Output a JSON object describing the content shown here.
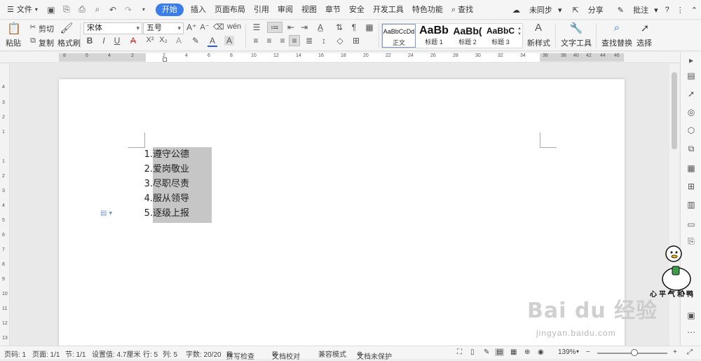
{
  "menu": {
    "file": "文件",
    "tabs": [
      "开始",
      "插入",
      "页面布局",
      "引用",
      "审阅",
      "视图",
      "章节",
      "安全",
      "开发工具",
      "特色功能"
    ],
    "search": "查找",
    "sync": "未同步",
    "share": "分享",
    "comment": "批注"
  },
  "ribbon": {
    "paste": "粘贴",
    "cut": "剪切",
    "copy": "复制",
    "format_painter": "格式刷",
    "font_name": "宋体",
    "font_size": "五号",
    "styles": [
      {
        "sample": "AaBbCcDd",
        "name": "正文"
      },
      {
        "sample": "AaBb",
        "name": "标题 1"
      },
      {
        "sample": "AaBb(",
        "name": "标题 2"
      },
      {
        "sample": "AaBbC",
        "name": "标题 3"
      }
    ],
    "new_style": "新样式",
    "text_tools": "文字工具",
    "find_replace": "查找替换",
    "select": "选择"
  },
  "ruler": {
    "h_ticks": [
      "8",
      "6",
      "4",
      "2",
      "2",
      "4",
      "6",
      "8",
      "10",
      "12",
      "14",
      "16",
      "18",
      "20",
      "22",
      "24",
      "26",
      "28",
      "30",
      "32",
      "34",
      "36",
      "38",
      "40",
      "42",
      "44",
      "46"
    ],
    "v_ticks": [
      "4",
      "3",
      "2",
      "1",
      "1",
      "2",
      "3",
      "4",
      "5",
      "6",
      "7",
      "8",
      "9",
      "10",
      "11",
      "12",
      "13"
    ]
  },
  "document": {
    "list": [
      {
        "num": "1.",
        "text": "遵守公德"
      },
      {
        "num": "2.",
        "text": "爱岗敬业"
      },
      {
        "num": "3.",
        "text": "尽职尽责"
      },
      {
        "num": "4.",
        "text": "服从领导"
      },
      {
        "num": "5.",
        "text": "逐级上报"
      }
    ]
  },
  "status": {
    "page_num": "页码: 1",
    "pages": "页面: 1/1",
    "section": "节: 1/1",
    "setting": "设置值: 4.7厘米",
    "row": "行: 5",
    "col": "列: 5",
    "word_count": "字数: 20/20",
    "spell_check": "拼写检查",
    "doc_proof": "文档校对",
    "compat_mode": "兼容模式",
    "unprotected": "文档未保护",
    "zoom": "139%"
  },
  "watermark": {
    "brand": "Bai du 经验",
    "url": "jingyan.baidu.com",
    "duck_caption": "心平气和鸭"
  }
}
